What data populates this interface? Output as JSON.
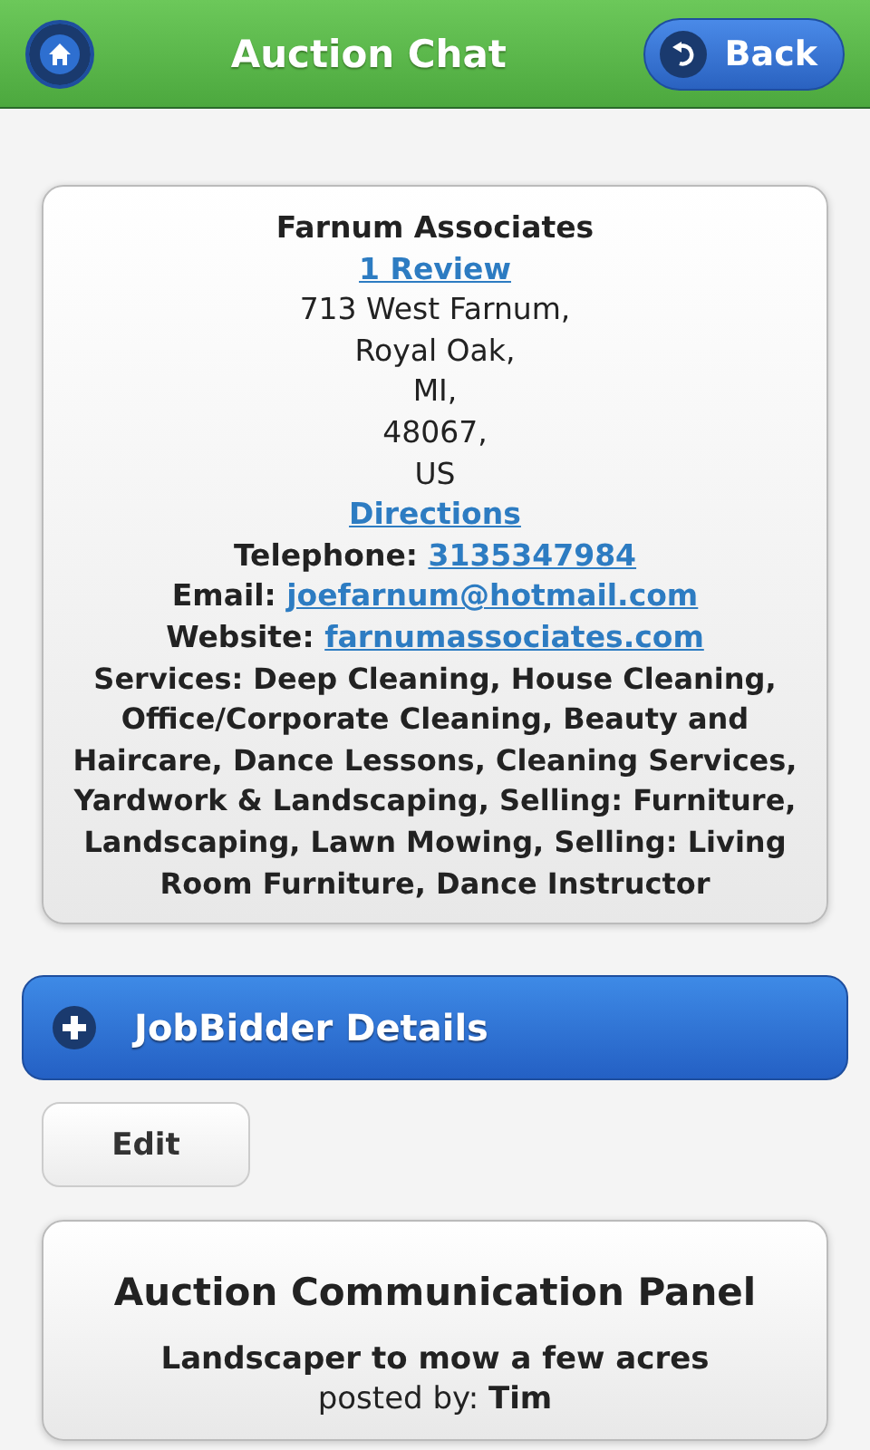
{
  "header": {
    "title": "Auction Chat",
    "back_label": "Back"
  },
  "business": {
    "name": "Farnum Associates",
    "review_link": "1 Review",
    "address_lines": [
      "713 West Farnum,",
      "Royal Oak,",
      "MI,",
      "48067,",
      "US"
    ],
    "directions_link": "Directions",
    "contacts": [
      {
        "label": "Telephone:",
        "value": "3135347984"
      },
      {
        "label": "Email:",
        "value": "joefarnum@hotmail.com"
      },
      {
        "label": "Website:",
        "value": "farnumassociates.com"
      }
    ],
    "services": "Services: Deep Cleaning, House Cleaning, Office/Corporate Cleaning, Beauty and Haircare, Dance Lessons, Cleaning Services, Yardwork & Landscaping, Selling: Furniture, Landscaping, Lawn Mowing, Selling: Living Room Furniture, Dance Instructor"
  },
  "collapsible": {
    "title": "JobBidder Details",
    "expanded": false
  },
  "edit_button": "Edit",
  "panel": {
    "title": "Auction Communication Panel",
    "job_title": "Landscaper to mow a few acres",
    "posted_by": "posted by: **Tim**"
  }
}
